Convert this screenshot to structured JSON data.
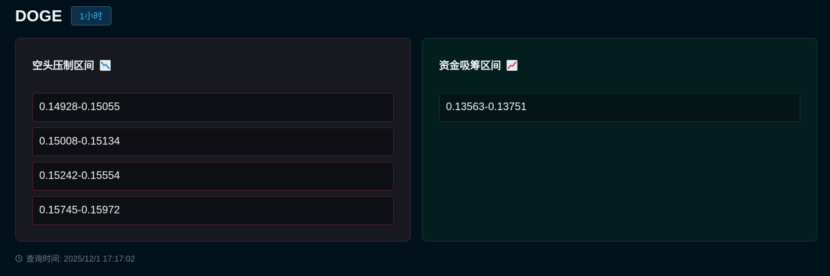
{
  "header": {
    "symbol": "DOGE",
    "timeframe": "1小时"
  },
  "short_panel": {
    "title": "空头压制区间",
    "icon": "chart-decreasing-icon",
    "zones": [
      "0.14928-0.15055",
      "0.15008-0.15134",
      "0.15242-0.15554",
      "0.15745-0.15972"
    ]
  },
  "long_panel": {
    "title": "资金吸筹区间",
    "icon": "chart-increasing-icon",
    "zones": [
      "0.13563-0.13751"
    ]
  },
  "footer": {
    "icon": "clock-icon",
    "query_time": "查询时间: 2025/12/1 17:17:02"
  },
  "colors": {
    "background": "#01111b",
    "badge_text": "#31b7ec",
    "short_border": "#4a1e2a",
    "long_panel_bg": "#021e1f"
  }
}
